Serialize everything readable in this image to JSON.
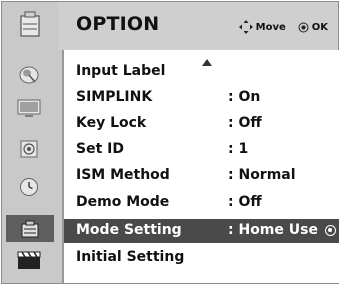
{
  "header": {
    "title": "OPTION",
    "hint_move": "Move",
    "hint_ok": "OK"
  },
  "sidebar": {
    "items": [
      {
        "icon": "satellite-dish-icon"
      },
      {
        "icon": "monitor-icon"
      },
      {
        "icon": "speaker-icon"
      },
      {
        "icon": "clock-icon"
      },
      {
        "icon": "option-box-icon",
        "selected": true
      },
      {
        "icon": "clapperboard-icon"
      }
    ]
  },
  "menu": {
    "items": [
      {
        "label": "Input Label",
        "value": ""
      },
      {
        "label": "SIMPLINK",
        "value": ": On"
      },
      {
        "label": "Key Lock",
        "value": ": Off"
      },
      {
        "label": "Set ID",
        "value": ": 1"
      },
      {
        "label": "ISM Method",
        "value": ": Normal"
      },
      {
        "label": "Demo Mode",
        "value": ": Off"
      },
      {
        "label": "Mode Setting",
        "value": ": Home Use",
        "highlighted": true
      },
      {
        "label": "Initial Setting",
        "value": ""
      }
    ]
  },
  "colors": {
    "highlight_bg": "#4a4a4a",
    "panel_bg": "#c9c9c9",
    "content_bg": "#ffffff"
  }
}
